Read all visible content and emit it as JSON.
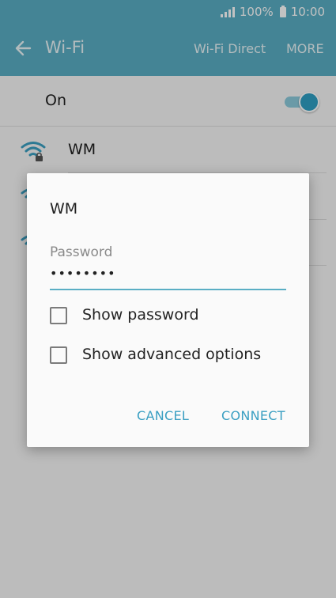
{
  "status_bar": {
    "battery": "100%",
    "time": "10:00"
  },
  "app_bar": {
    "title": "Wi-Fi",
    "wifi_direct": "Wi-Fi Direct",
    "more": "MORE"
  },
  "wifi_toggle": {
    "label": "On",
    "enabled": true
  },
  "networks": [
    {
      "name": "WM",
      "secured": true
    }
  ],
  "dialog": {
    "title": "WM",
    "password_label": "Password",
    "password_value": "••••••••",
    "show_password": "Show password",
    "show_advanced": "Show advanced options",
    "cancel": "CANCEL",
    "connect": "CONNECT"
  },
  "colors": {
    "accent": "#5aaec4",
    "button": "#3a9fc2"
  }
}
